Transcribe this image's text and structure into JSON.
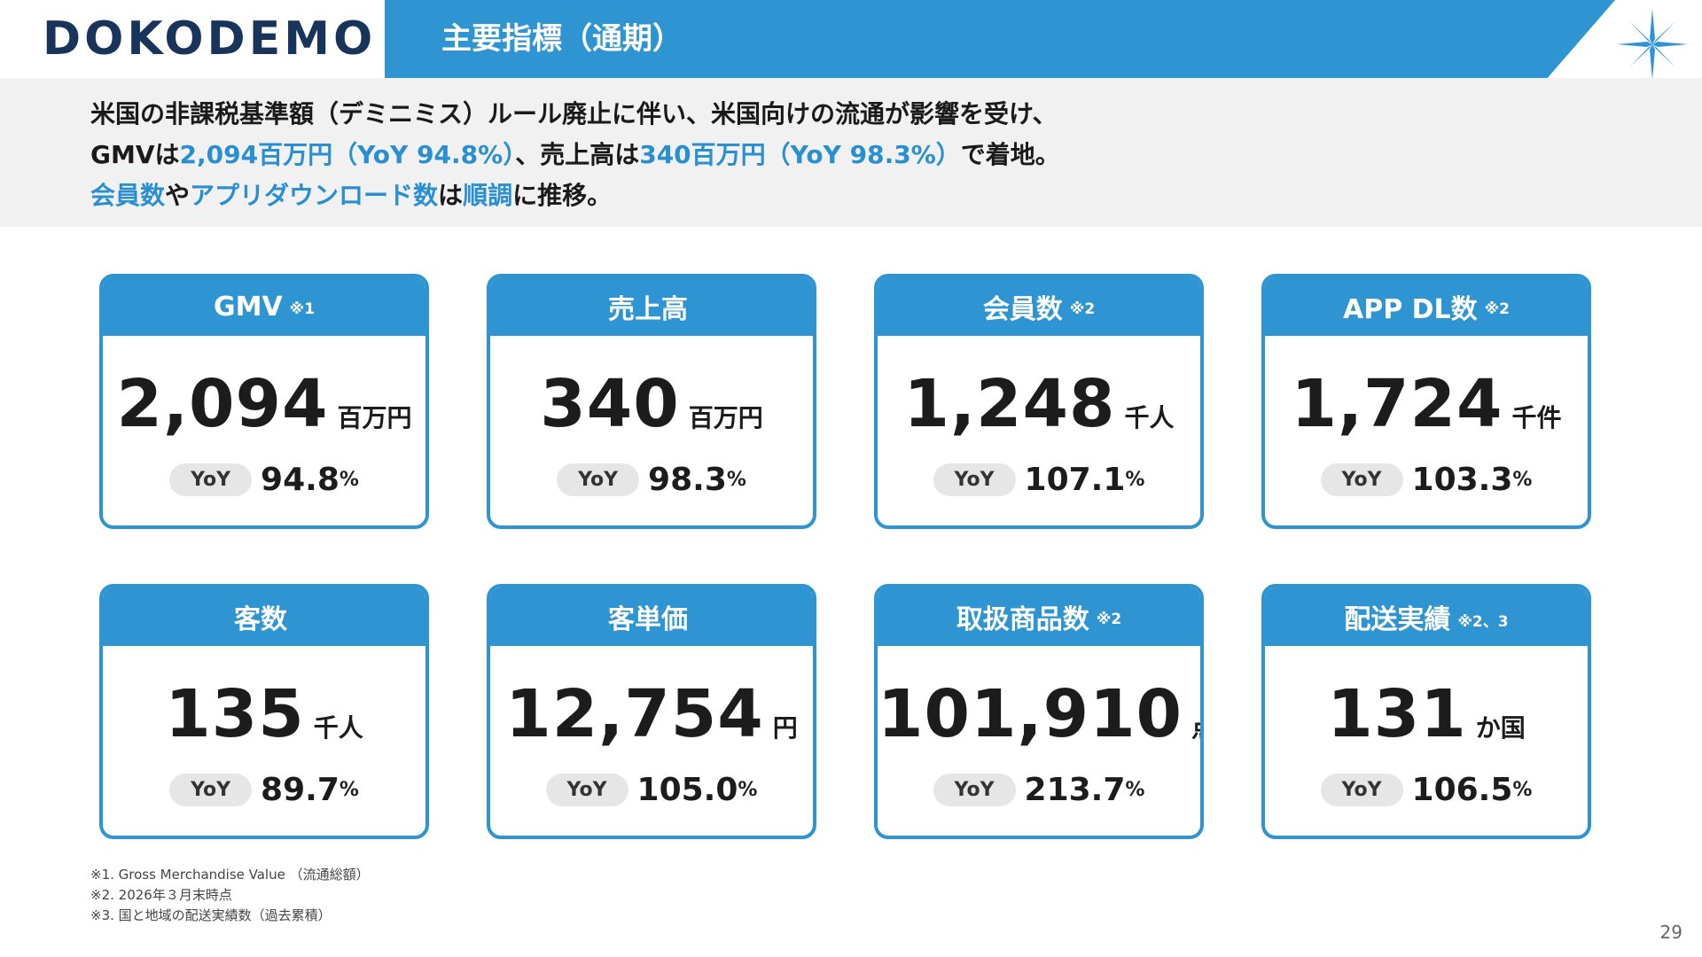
{
  "header": {
    "logo": "DOKODEMO",
    "title": "主要指標（通期）"
  },
  "summary": {
    "line1": "米国の非課税基準額（デミニミス）ルール廃止に伴い、米国向けの流通が影響を受け、",
    "line2_a": "GMVは",
    "line2_b": "2,094百万円（YoY 94.8%）",
    "line2_c": "、売上高は",
    "line2_d": "340百万円（YoY 98.3%）",
    "line2_e": "で着地。",
    "line3_a": "会員数",
    "line3_b": "や",
    "line3_c": "アプリダウンロード数",
    "line3_d": "は",
    "line3_e": "順調",
    "line3_f": "に推移。"
  },
  "cards": [
    {
      "label": "GMV",
      "note": "※1",
      "value": "2,094",
      "unit": "百万円",
      "yoy_label": "YoY",
      "yoy": "94.8",
      "pct": "%"
    },
    {
      "label": "売上高",
      "note": "",
      "value": "340",
      "unit": "百万円",
      "yoy_label": "YoY",
      "yoy": "98.3",
      "pct": "%"
    },
    {
      "label": "会員数",
      "note": "※2",
      "value": "1,248",
      "unit": "千人",
      "yoy_label": "YoY",
      "yoy": "107.1",
      "pct": "%"
    },
    {
      "label": "APP DL数",
      "note": "※2",
      "value": "1,724",
      "unit": "千件",
      "yoy_label": "YoY",
      "yoy": "103.3",
      "pct": "%"
    },
    {
      "label": "客数",
      "note": "",
      "value": "135",
      "unit": "千人",
      "yoy_label": "YoY",
      "yoy": "89.7",
      "pct": "%"
    },
    {
      "label": "客単価",
      "note": "",
      "value": "12,754",
      "unit": "円",
      "yoy_label": "YoY",
      "yoy": "105.0",
      "pct": "%"
    },
    {
      "label": "取扱商品数",
      "note": "※2",
      "value": "101,910",
      "unit": "点",
      "yoy_label": "YoY",
      "yoy": "213.7",
      "pct": "%"
    },
    {
      "label": "配送実績",
      "note": "※2、3",
      "value": "131",
      "unit": "か国",
      "yoy_label": "YoY",
      "yoy": "106.5",
      "pct": "%"
    }
  ],
  "footnotes": [
    "※1. Gross Merchandise Value （流通総額）",
    "※2. 2026年３月末時点",
    "※3. 国と地域の配送実績数（過去累積）"
  ],
  "page_number": "29",
  "colors": {
    "accent": "#2e94d2",
    "logo": "#18345a",
    "summary_bg": "#f1f1f1",
    "pill_bg": "#e6e6e6"
  }
}
